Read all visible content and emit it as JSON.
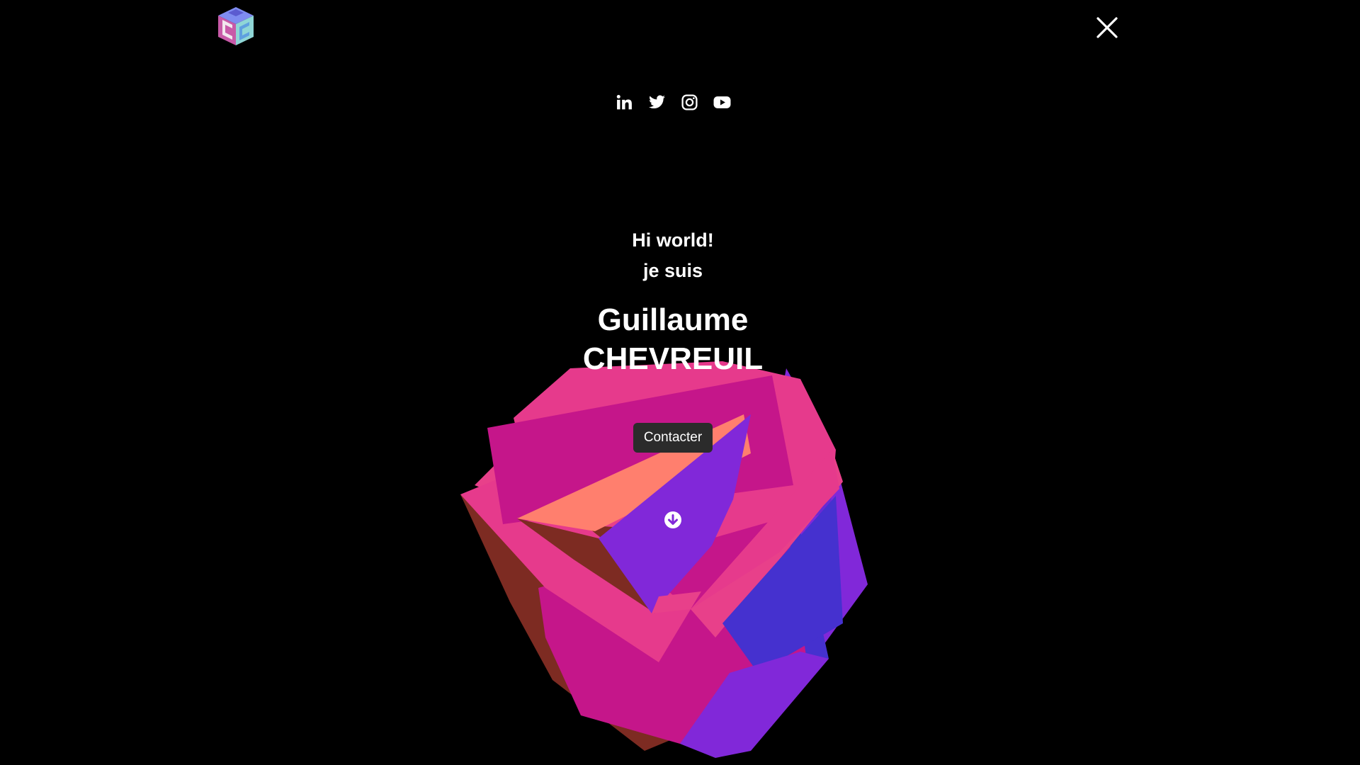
{
  "header": {
    "logo_icon": "gc-cube-logo-icon",
    "close_icon": "close-icon"
  },
  "socials": [
    {
      "name": "linkedin",
      "icon": "linkedin-icon"
    },
    {
      "name": "twitter",
      "icon": "twitter-icon"
    },
    {
      "name": "instagram",
      "icon": "instagram-icon"
    },
    {
      "name": "youtube",
      "icon": "youtube-icon"
    }
  ],
  "hero": {
    "greeting_line1": "Hi world!",
    "greeting_line2": "je suis",
    "first_name": "Guillaume",
    "last_name": "CHEVREUIL",
    "contact_label": "Contacter",
    "scroll_icon": "arrow-down-circle-icon"
  },
  "colors": {
    "background": "#000000",
    "text": "#ffffff",
    "button_bg": "#2b2b2b",
    "shape_pink": "#e63a8c",
    "shape_magenta": "#c5168a",
    "shape_salmon": "#ff7f6e",
    "shape_purple": "#8128d9",
    "shape_blue": "#4531cf",
    "shape_brown": "#7d2b22"
  }
}
